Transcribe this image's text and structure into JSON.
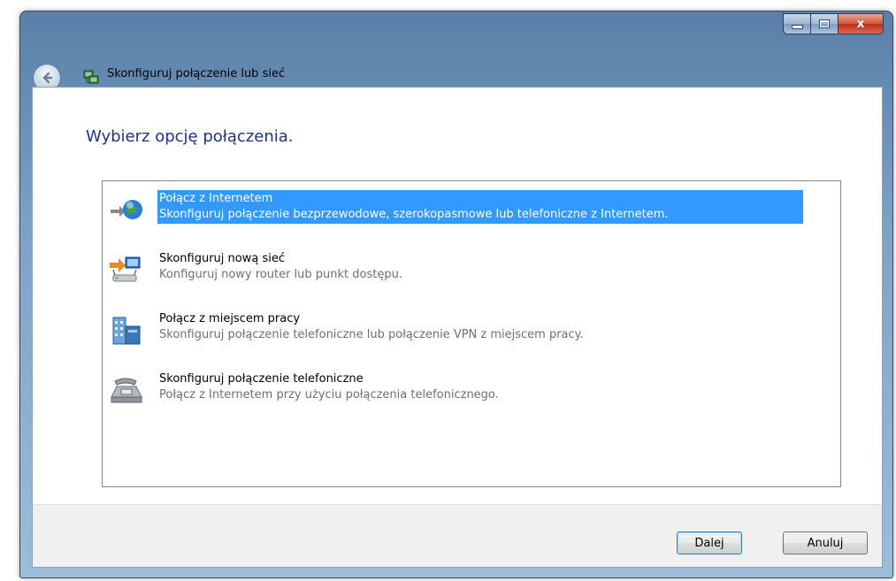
{
  "window": {
    "title": "Skonfiguruj połączenie lub sieć",
    "close_glyph": "x"
  },
  "page": {
    "heading": "Wybierz opcję połączenia."
  },
  "options": [
    {
      "title": "Połącz z Internetem",
      "description": "Skonfiguruj połączenie bezprzewodowe, szerokopasmowe lub telefoniczne z Internetem.",
      "icon": "globe-network-icon",
      "selected": true
    },
    {
      "title": "Skonfiguruj nową sieć",
      "description": "Konfiguruj nowy router lub punkt dostępu.",
      "icon": "new-network-router-icon",
      "selected": false
    },
    {
      "title": "Połącz z miejscem pracy",
      "description": "Skonfiguruj połączenie telefoniczne lub połączenie VPN z miejscem pracy.",
      "icon": "workplace-building-icon",
      "selected": false
    },
    {
      "title": "Skonfiguruj połączenie telefoniczne",
      "description": "Połącz z Internetem przy użyciu połączenia telefonicznego.",
      "icon": "dialup-modem-icon",
      "selected": false
    }
  ],
  "buttons": {
    "next": "Dalej",
    "cancel": "Anuluj"
  },
  "colors": {
    "selection": "#3399ff",
    "heading": "#1e3287"
  }
}
